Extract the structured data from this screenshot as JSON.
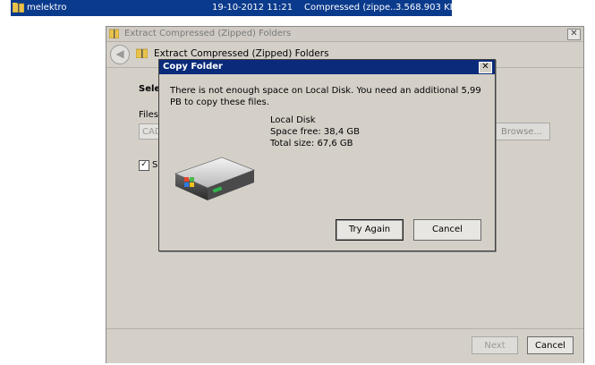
{
  "explorer_row": {
    "name": "melektro",
    "date": "19-10-2012 11:21",
    "type": "Compressed (zippe...",
    "size": "3.568.903 KB",
    "icon": "zip-folder-icon"
  },
  "wizard": {
    "title": "Extract Compressed (Zipped) Folders",
    "header": "Extract Compressed (Zipped) Folders",
    "select_label": "Selec",
    "files_label": "Files",
    "path_value": "CAD",
    "browse_label": "Browse...",
    "checkbox_label": "Sl",
    "checkbox_checked": true,
    "next_label": "Next",
    "cancel_label": "Cancel",
    "close_glyph": "✕",
    "back_glyph": "◀"
  },
  "dialog": {
    "title": "Copy Folder",
    "message": "There is not enough space on Local Disk. You need an additional 5,99 PB to copy these files.",
    "disk_name": "Local Disk",
    "space_free": "Space free: 38,4 GB",
    "total_size": "Total size: 67,6 GB",
    "try_again_label": "Try Again",
    "cancel_label": "Cancel",
    "close_glyph": "✕",
    "icon": "hard-disk-icon"
  },
  "colors": {
    "selection_blue": "#0a3a8c",
    "dialog_title_blue": "#0a2b7a",
    "window_gray": "#d4d0c8"
  }
}
